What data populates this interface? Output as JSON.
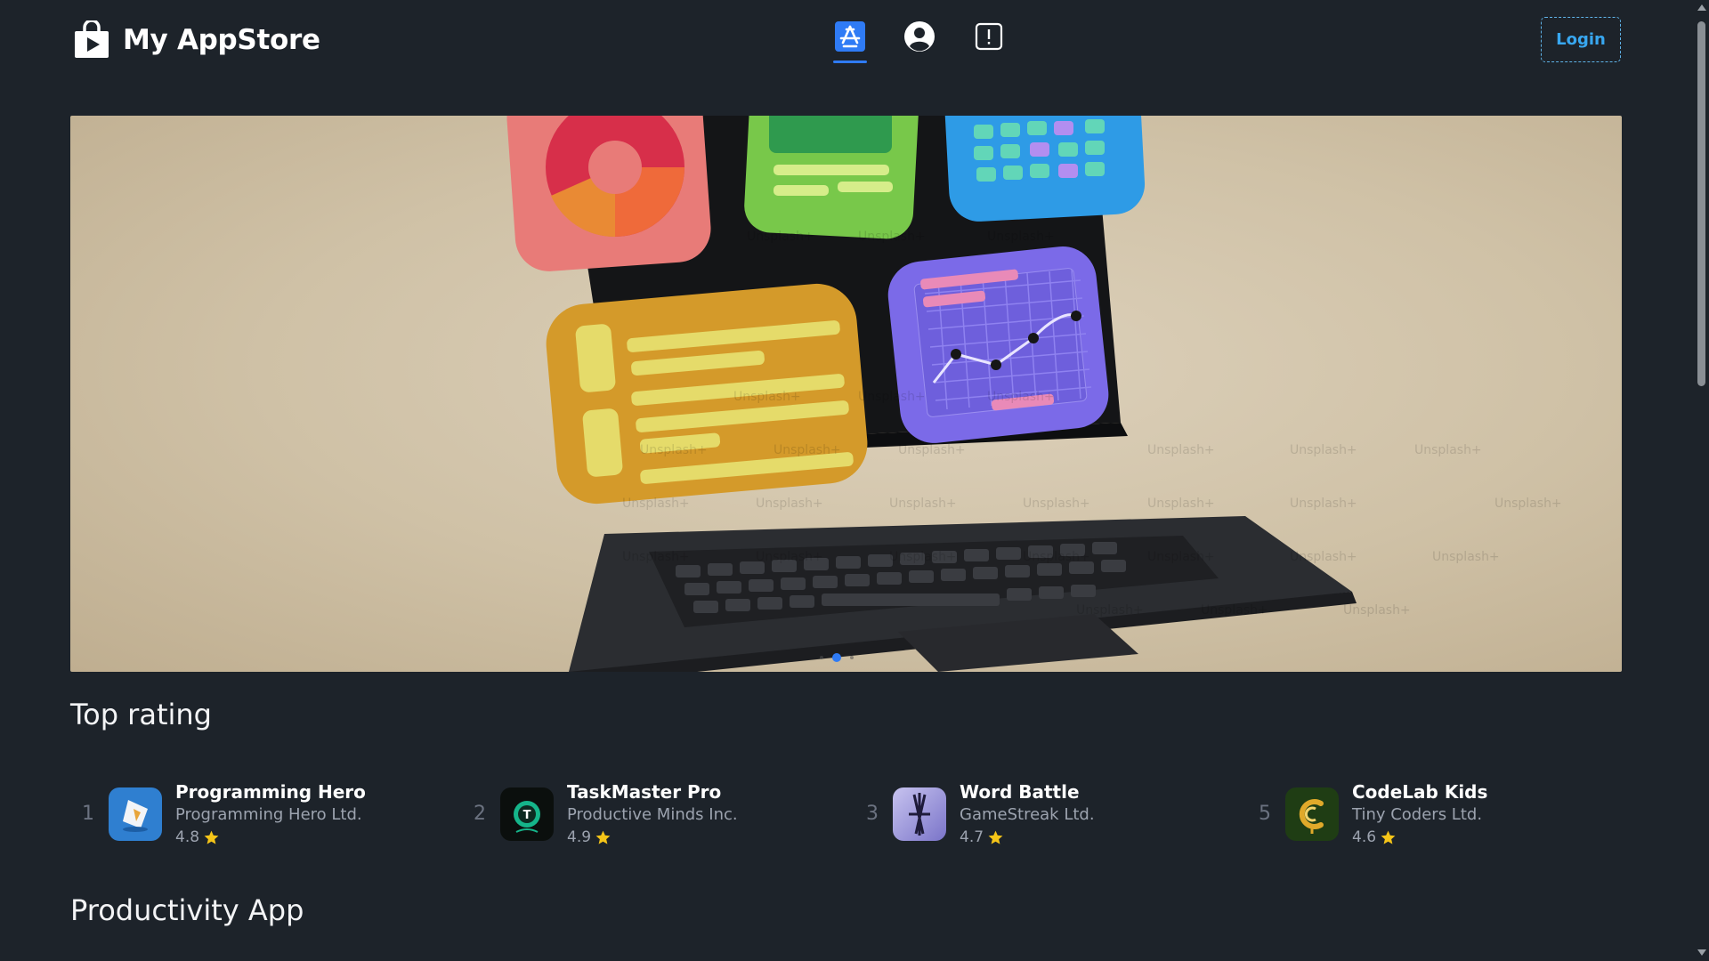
{
  "header": {
    "brand_name": "My AppStore",
    "nav": [
      {
        "name": "apps",
        "icon": "app-store-icon",
        "active": true
      },
      {
        "name": "profile",
        "icon": "user-circle-icon",
        "active": false
      },
      {
        "name": "report",
        "icon": "alert-square-icon",
        "active": false
      }
    ],
    "login_label": "Login"
  },
  "hero": {
    "watermark": "Unsplash+",
    "slides_count": 3,
    "active_slide": 2
  },
  "sections": {
    "top_rating": "Top rating",
    "productivity": "Productivity App"
  },
  "top_apps": [
    {
      "rank": "1",
      "name": "Programming Hero",
      "developer": "Programming Hero Ltd.",
      "rating": "4.8",
      "icon": "programming-hero-icon"
    },
    {
      "rank": "2",
      "name": "TaskMaster Pro",
      "developer": "Productive Minds Inc.",
      "rating": "4.9",
      "icon": "taskmaster-icon"
    },
    {
      "rank": "3",
      "name": "Word Battle",
      "developer": "GameStreak Ltd.",
      "rating": "4.7",
      "icon": "word-battle-icon"
    },
    {
      "rank": "5",
      "name": "CodeLab Kids",
      "developer": "Tiny Coders Ltd.",
      "rating": "4.6",
      "icon": "codelab-kids-icon"
    }
  ],
  "colors": {
    "background": "#1d232a",
    "accent": "#2f7bf5",
    "login": "#38a7f0",
    "star": "#f5c518"
  }
}
